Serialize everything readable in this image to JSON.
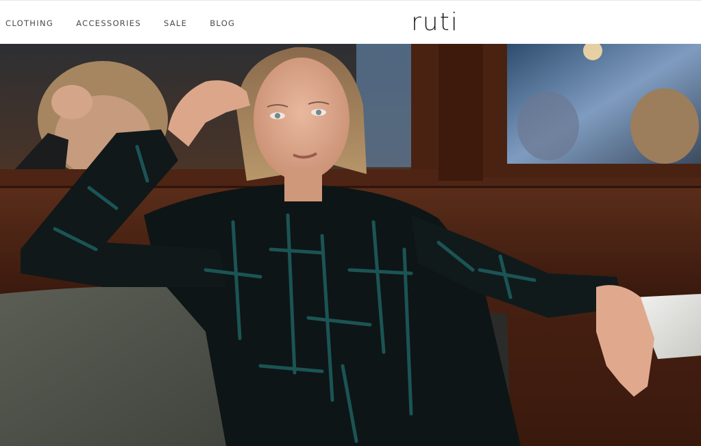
{
  "header": {
    "nav": [
      {
        "label": "CLOTHING"
      },
      {
        "label": "ACCESSORIES"
      },
      {
        "label": "SALE"
      },
      {
        "label": "BLOG"
      }
    ],
    "logo": "ruti"
  },
  "hero": {
    "image_icon": "fashion-model-photo"
  },
  "colors": {
    "header_bg": "#ffffff",
    "nav_text": "#4a4a4a",
    "logo_text": "#1f1f1f",
    "dress_base": "#0e1516",
    "dress_print": "#1d5b5c"
  }
}
